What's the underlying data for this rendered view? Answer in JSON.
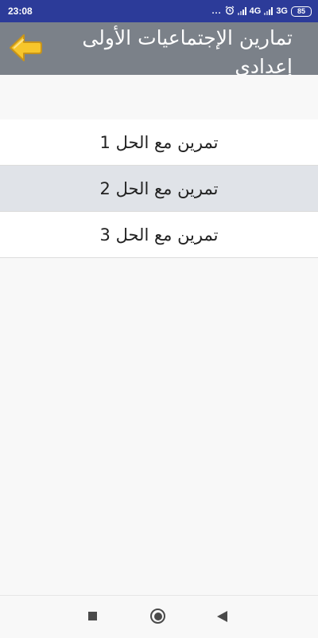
{
  "status_bar": {
    "time": "23:08",
    "overflow_dots": "...",
    "network_1": "4G",
    "network_2": "3G",
    "battery": "85"
  },
  "app_bar": {
    "title": "تمارين الإجتماعيات الأولى إعدادي",
    "back_icon": "arrow-left-icon"
  },
  "list": {
    "items": [
      {
        "label": "تمرين مع الحل 1"
      },
      {
        "label": "تمرين مع الحل 2"
      },
      {
        "label": "تمرين مع الحل 3"
      }
    ]
  },
  "colors": {
    "status_bar": "#2c3b99",
    "app_bar": "#7b8189",
    "selected_row": "#e0e3e8",
    "back_arrow": "#f7c62b"
  },
  "nav_bar": {
    "icons": [
      "square-recents-icon",
      "circle-home-icon",
      "triangle-back-icon"
    ]
  }
}
